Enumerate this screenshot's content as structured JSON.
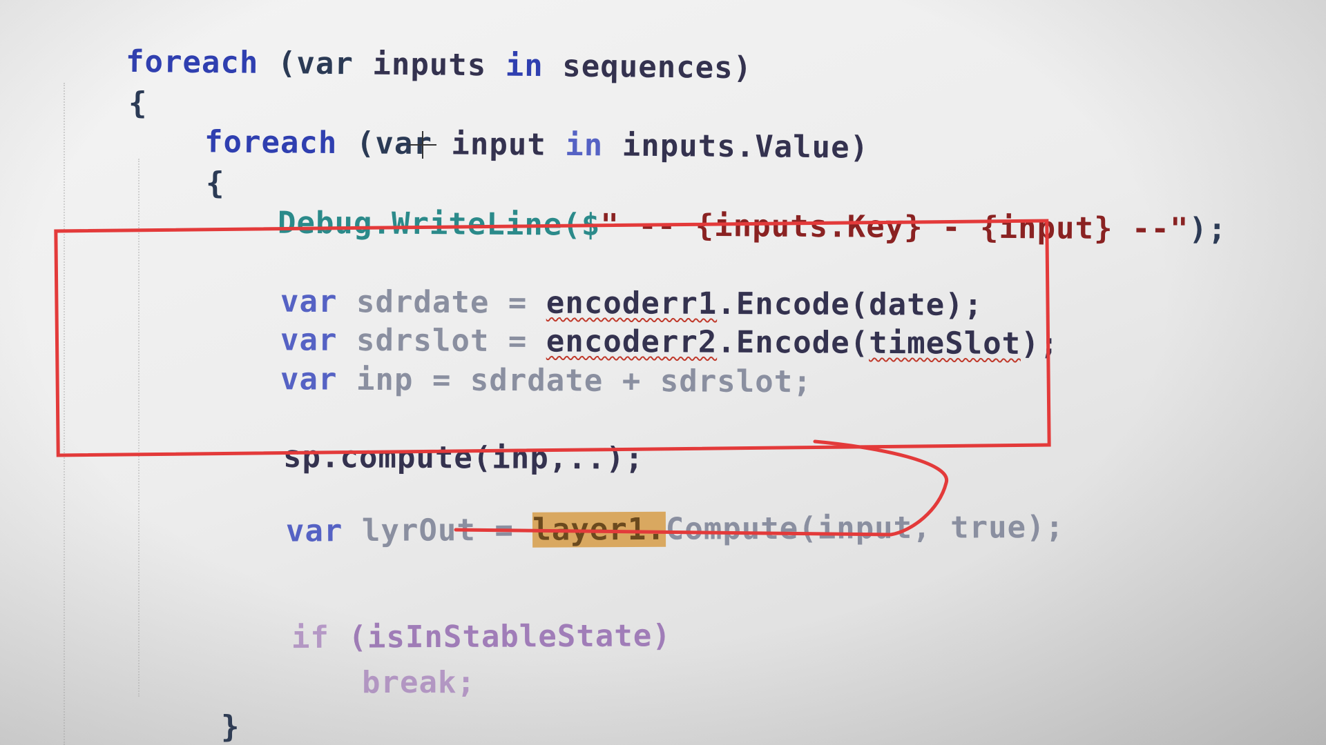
{
  "editor": {
    "language": "C#",
    "lines": [
      {
        "text_foreach": "foreach",
        "text_open": " (var ",
        "text_var_name": "inputs",
        "text_in": " in ",
        "text_seq": "sequences)"
      },
      {
        "brace": "{"
      },
      {
        "text_foreach": "foreach",
        "text_open": " (var ",
        "text_var_name": "input",
        "text_in": " in ",
        "text_seq": "inputs.Value)"
      },
      {
        "brace": "{"
      },
      {
        "debug_type": "Debug",
        "debug_call": ".WriteLine($",
        "debug_str": "\" -- {inputs.Key} - {input} --\"",
        "debug_end": ");"
      },
      {
        "kw": "var",
        "rest_a": " sdrdate = ",
        "rest_b": "encoderr1",
        "rest_c": ".Encode(date);"
      },
      {
        "kw": "var",
        "rest_a": " sdrslot = ",
        "rest_b": "encoderr2",
        "rest_c": ".Encode(",
        "rest_d": "timeSlot",
        "rest_e": ");"
      },
      {
        "kw": "var",
        "rest_a": " inp = sdrdate + sdrslot;"
      },
      {
        "text": "sp.compute(inp,..);"
      },
      {
        "kw": "var",
        "rest_a": " lyrOut = ",
        "highlight": "layer1.",
        "rest_c": "Compute(input, true);"
      },
      {
        "kw": "if",
        "rest_a": " (isInStableState)"
      },
      {
        "text": "break;"
      },
      {
        "brace": "}"
      }
    ]
  },
  "annotations": {
    "box_color": "#e33a3a",
    "ellipse_color": "#e33a3a"
  }
}
